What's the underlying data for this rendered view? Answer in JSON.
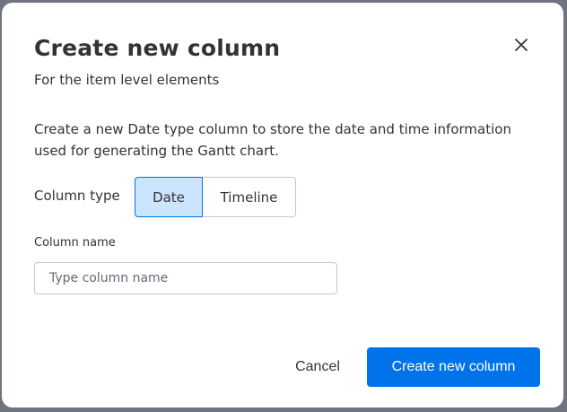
{
  "dialog": {
    "title": "Create new column",
    "subtitle": "For the item level elements",
    "description": "Create a new Date type column to store the date and time information used for generating the Gantt chart.",
    "close_icon": "close-icon"
  },
  "column_type": {
    "label": "Column type",
    "options": [
      {
        "label": "Date",
        "selected": true
      },
      {
        "label": "Timeline",
        "selected": false
      }
    ]
  },
  "column_name": {
    "label": "Column name",
    "value": "",
    "placeholder": "Type column name"
  },
  "actions": {
    "cancel_label": "Cancel",
    "create_label": "Create new column"
  },
  "colors": {
    "primary": "#0073ea",
    "selected_bg": "#cce5ff",
    "text": "#323338",
    "border": "#c3c6d4",
    "backdrop": "#6f7480"
  }
}
